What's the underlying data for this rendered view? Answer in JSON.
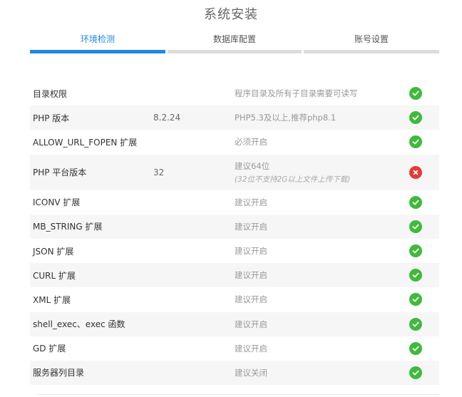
{
  "page": {
    "title": "系统安装"
  },
  "steps": [
    {
      "label": "环境检测",
      "active": true
    },
    {
      "label": "数据库配置",
      "active": false
    },
    {
      "label": "账号设置",
      "active": false
    }
  ],
  "checks": [
    {
      "name": "目录权限",
      "current": "",
      "requirement": "程序目录及所有子目录需要可读写",
      "note": "",
      "status": "ok"
    },
    {
      "name": "PHP 版本",
      "current": "8.2.24",
      "requirement": "PHP5.3及以上,推荐php8.1",
      "note": "",
      "status": "ok"
    },
    {
      "name": "ALLOW_URL_FOPEN 扩展",
      "current": "",
      "requirement": "必须开启",
      "note": "",
      "status": "ok"
    },
    {
      "name": "PHP 平台版本",
      "current": "32",
      "requirement": "建议64位",
      "note": "(32位不支持2G以上文件上传下载)",
      "status": "fail"
    },
    {
      "name": "ICONV 扩展",
      "current": "",
      "requirement": "建议开启",
      "note": "",
      "status": "ok"
    },
    {
      "name": "MB_STRING 扩展",
      "current": "",
      "requirement": "建议开启",
      "note": "",
      "status": "ok"
    },
    {
      "name": "JSON 扩展",
      "current": "",
      "requirement": "建议开启",
      "note": "",
      "status": "ok"
    },
    {
      "name": "CURL 扩展",
      "current": "",
      "requirement": "建议开启",
      "note": "",
      "status": "ok"
    },
    {
      "name": "XML 扩展",
      "current": "",
      "requirement": "建议开启",
      "note": "",
      "status": "ok"
    },
    {
      "name": "shell_exec、exec 函数",
      "current": "",
      "requirement": "建议开启",
      "note": "",
      "status": "ok"
    },
    {
      "name": "GD 扩展",
      "current": "",
      "requirement": "建议开启",
      "note": "",
      "status": "ok"
    },
    {
      "name": "服务器列目录",
      "current": "",
      "requirement": "建议关闭",
      "note": "",
      "status": "ok"
    }
  ],
  "colors": {
    "accent": "#1e88e5",
    "ok": "#3fba3c",
    "fail": "#e53935",
    "inactive_bar": "#dcdcdc"
  }
}
